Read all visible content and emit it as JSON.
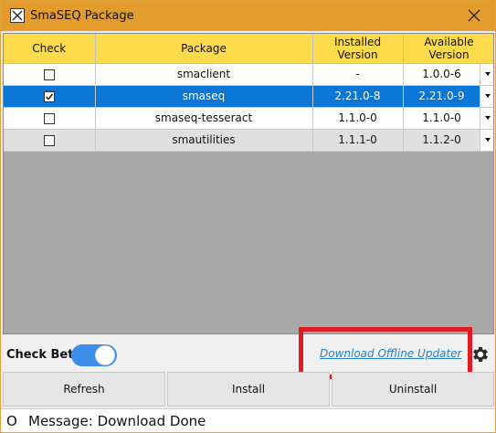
{
  "window": {
    "title": "SmaSEQ Package"
  },
  "table": {
    "headers": {
      "check": "Check",
      "package": "Package",
      "installed_line1": "Installed",
      "installed_line2": "Version",
      "available_line1": "Available",
      "available_line2": "Version"
    },
    "rows": [
      {
        "checked": false,
        "package": "smaclient",
        "installed": "-",
        "available": "1.0.0-6",
        "selected": false
      },
      {
        "checked": true,
        "package": "smaseq",
        "installed": "2.21.0-8",
        "available": "2.21.0-9",
        "selected": true
      },
      {
        "checked": false,
        "package": "smaseq-tesseract",
        "installed": "1.1.0-0",
        "available": "1.1.0-0",
        "selected": false
      },
      {
        "checked": false,
        "package": "smautilities",
        "installed": "1.1.1-0",
        "available": "1.1.2-0",
        "selected": false
      }
    ]
  },
  "options": {
    "check_beta_label": "Check Beta",
    "check_beta_on": true,
    "offline_updater_link": "Download Offline Updater"
  },
  "buttons": {
    "refresh": "Refresh",
    "install": "Install",
    "uninstall": "Uninstall"
  },
  "status": {
    "indicator": "O",
    "message": "Message: Download Done"
  },
  "colors": {
    "titlebar": "#e49d2d",
    "header": "#fedb4b",
    "selection": "#0a76d6",
    "toggle": "#3c8fe8",
    "highlight": "#e01c23",
    "link": "#2a7fc1"
  }
}
